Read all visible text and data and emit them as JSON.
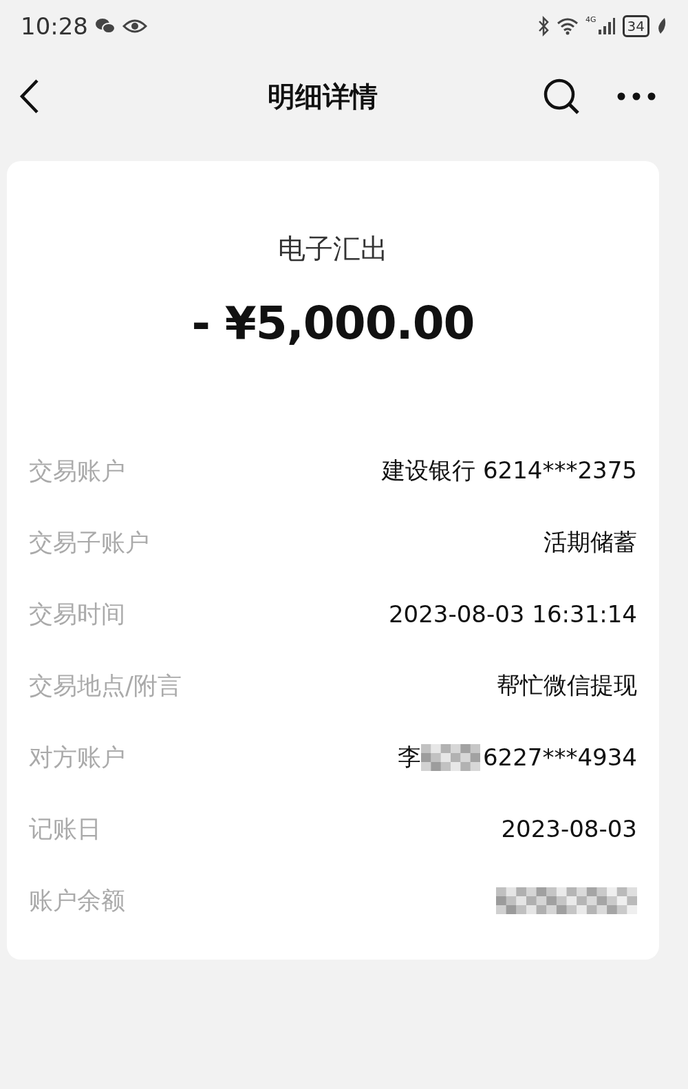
{
  "status_bar": {
    "time": "10:28",
    "network": "4G",
    "battery": "34"
  },
  "header": {
    "title": "明细详情"
  },
  "transaction": {
    "type": "电子汇出",
    "amount": "- ¥5,000.00"
  },
  "details": [
    {
      "label": "交易账户",
      "value": "建设银行 6214***2375",
      "kind": "text"
    },
    {
      "label": "交易子账户",
      "value": "活期储蓄",
      "kind": "text"
    },
    {
      "label": "交易时间",
      "value": "2023-08-03 16:31:14",
      "kind": "text"
    },
    {
      "label": "交易地点/附言",
      "value": "帮忙微信提现",
      "kind": "text"
    },
    {
      "label": "对方账户",
      "prefix": "李",
      "value": "6227***4934",
      "kind": "partly_masked"
    },
    {
      "label": "记账日",
      "value": "2023-08-03",
      "kind": "text"
    },
    {
      "label": "账户余额",
      "kind": "masked"
    }
  ]
}
